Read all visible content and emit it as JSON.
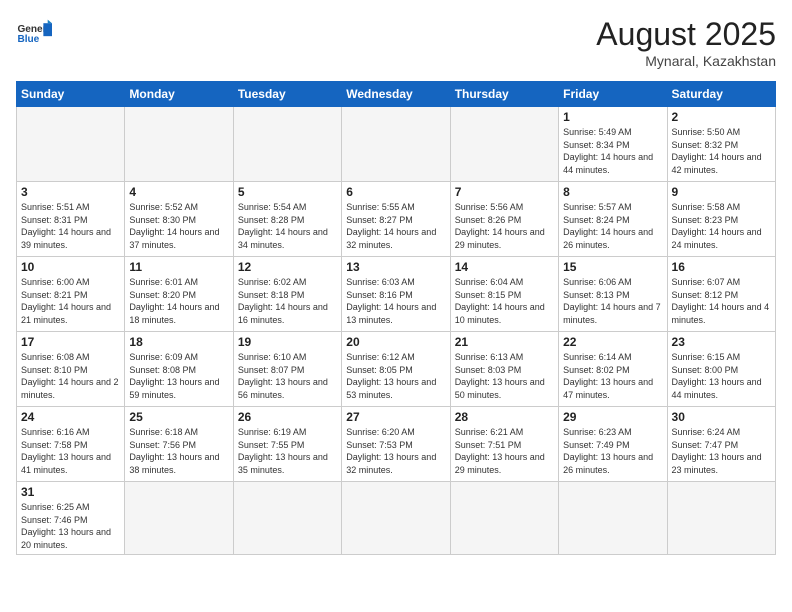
{
  "header": {
    "logo_text_normal": "General",
    "logo_text_blue": "Blue",
    "main_title": "August 2025",
    "sub_title": "Mynaral, Kazakhstan"
  },
  "weekdays": [
    "Sunday",
    "Monday",
    "Tuesday",
    "Wednesday",
    "Thursday",
    "Friday",
    "Saturday"
  ],
  "weeks": [
    [
      {
        "day": "",
        "info": ""
      },
      {
        "day": "",
        "info": ""
      },
      {
        "day": "",
        "info": ""
      },
      {
        "day": "",
        "info": ""
      },
      {
        "day": "",
        "info": ""
      },
      {
        "day": "1",
        "info": "Sunrise: 5:49 AM\nSunset: 8:34 PM\nDaylight: 14 hours and 44 minutes."
      },
      {
        "day": "2",
        "info": "Sunrise: 5:50 AM\nSunset: 8:32 PM\nDaylight: 14 hours and 42 minutes."
      }
    ],
    [
      {
        "day": "3",
        "info": "Sunrise: 5:51 AM\nSunset: 8:31 PM\nDaylight: 14 hours and 39 minutes."
      },
      {
        "day": "4",
        "info": "Sunrise: 5:52 AM\nSunset: 8:30 PM\nDaylight: 14 hours and 37 minutes."
      },
      {
        "day": "5",
        "info": "Sunrise: 5:54 AM\nSunset: 8:28 PM\nDaylight: 14 hours and 34 minutes."
      },
      {
        "day": "6",
        "info": "Sunrise: 5:55 AM\nSunset: 8:27 PM\nDaylight: 14 hours and 32 minutes."
      },
      {
        "day": "7",
        "info": "Sunrise: 5:56 AM\nSunset: 8:26 PM\nDaylight: 14 hours and 29 minutes."
      },
      {
        "day": "8",
        "info": "Sunrise: 5:57 AM\nSunset: 8:24 PM\nDaylight: 14 hours and 26 minutes."
      },
      {
        "day": "9",
        "info": "Sunrise: 5:58 AM\nSunset: 8:23 PM\nDaylight: 14 hours and 24 minutes."
      }
    ],
    [
      {
        "day": "10",
        "info": "Sunrise: 6:00 AM\nSunset: 8:21 PM\nDaylight: 14 hours and 21 minutes."
      },
      {
        "day": "11",
        "info": "Sunrise: 6:01 AM\nSunset: 8:20 PM\nDaylight: 14 hours and 18 minutes."
      },
      {
        "day": "12",
        "info": "Sunrise: 6:02 AM\nSunset: 8:18 PM\nDaylight: 14 hours and 16 minutes."
      },
      {
        "day": "13",
        "info": "Sunrise: 6:03 AM\nSunset: 8:16 PM\nDaylight: 14 hours and 13 minutes."
      },
      {
        "day": "14",
        "info": "Sunrise: 6:04 AM\nSunset: 8:15 PM\nDaylight: 14 hours and 10 minutes."
      },
      {
        "day": "15",
        "info": "Sunrise: 6:06 AM\nSunset: 8:13 PM\nDaylight: 14 hours and 7 minutes."
      },
      {
        "day": "16",
        "info": "Sunrise: 6:07 AM\nSunset: 8:12 PM\nDaylight: 14 hours and 4 minutes."
      }
    ],
    [
      {
        "day": "17",
        "info": "Sunrise: 6:08 AM\nSunset: 8:10 PM\nDaylight: 14 hours and 2 minutes."
      },
      {
        "day": "18",
        "info": "Sunrise: 6:09 AM\nSunset: 8:08 PM\nDaylight: 13 hours and 59 minutes."
      },
      {
        "day": "19",
        "info": "Sunrise: 6:10 AM\nSunset: 8:07 PM\nDaylight: 13 hours and 56 minutes."
      },
      {
        "day": "20",
        "info": "Sunrise: 6:12 AM\nSunset: 8:05 PM\nDaylight: 13 hours and 53 minutes."
      },
      {
        "day": "21",
        "info": "Sunrise: 6:13 AM\nSunset: 8:03 PM\nDaylight: 13 hours and 50 minutes."
      },
      {
        "day": "22",
        "info": "Sunrise: 6:14 AM\nSunset: 8:02 PM\nDaylight: 13 hours and 47 minutes."
      },
      {
        "day": "23",
        "info": "Sunrise: 6:15 AM\nSunset: 8:00 PM\nDaylight: 13 hours and 44 minutes."
      }
    ],
    [
      {
        "day": "24",
        "info": "Sunrise: 6:16 AM\nSunset: 7:58 PM\nDaylight: 13 hours and 41 minutes."
      },
      {
        "day": "25",
        "info": "Sunrise: 6:18 AM\nSunset: 7:56 PM\nDaylight: 13 hours and 38 minutes."
      },
      {
        "day": "26",
        "info": "Sunrise: 6:19 AM\nSunset: 7:55 PM\nDaylight: 13 hours and 35 minutes."
      },
      {
        "day": "27",
        "info": "Sunrise: 6:20 AM\nSunset: 7:53 PM\nDaylight: 13 hours and 32 minutes."
      },
      {
        "day": "28",
        "info": "Sunrise: 6:21 AM\nSunset: 7:51 PM\nDaylight: 13 hours and 29 minutes."
      },
      {
        "day": "29",
        "info": "Sunrise: 6:23 AM\nSunset: 7:49 PM\nDaylight: 13 hours and 26 minutes."
      },
      {
        "day": "30",
        "info": "Sunrise: 6:24 AM\nSunset: 7:47 PM\nDaylight: 13 hours and 23 minutes."
      }
    ],
    [
      {
        "day": "31",
        "info": "Sunrise: 6:25 AM\nSunset: 7:46 PM\nDaylight: 13 hours and 20 minutes."
      },
      {
        "day": "",
        "info": ""
      },
      {
        "day": "",
        "info": ""
      },
      {
        "day": "",
        "info": ""
      },
      {
        "day": "",
        "info": ""
      },
      {
        "day": "",
        "info": ""
      },
      {
        "day": "",
        "info": ""
      }
    ]
  ]
}
